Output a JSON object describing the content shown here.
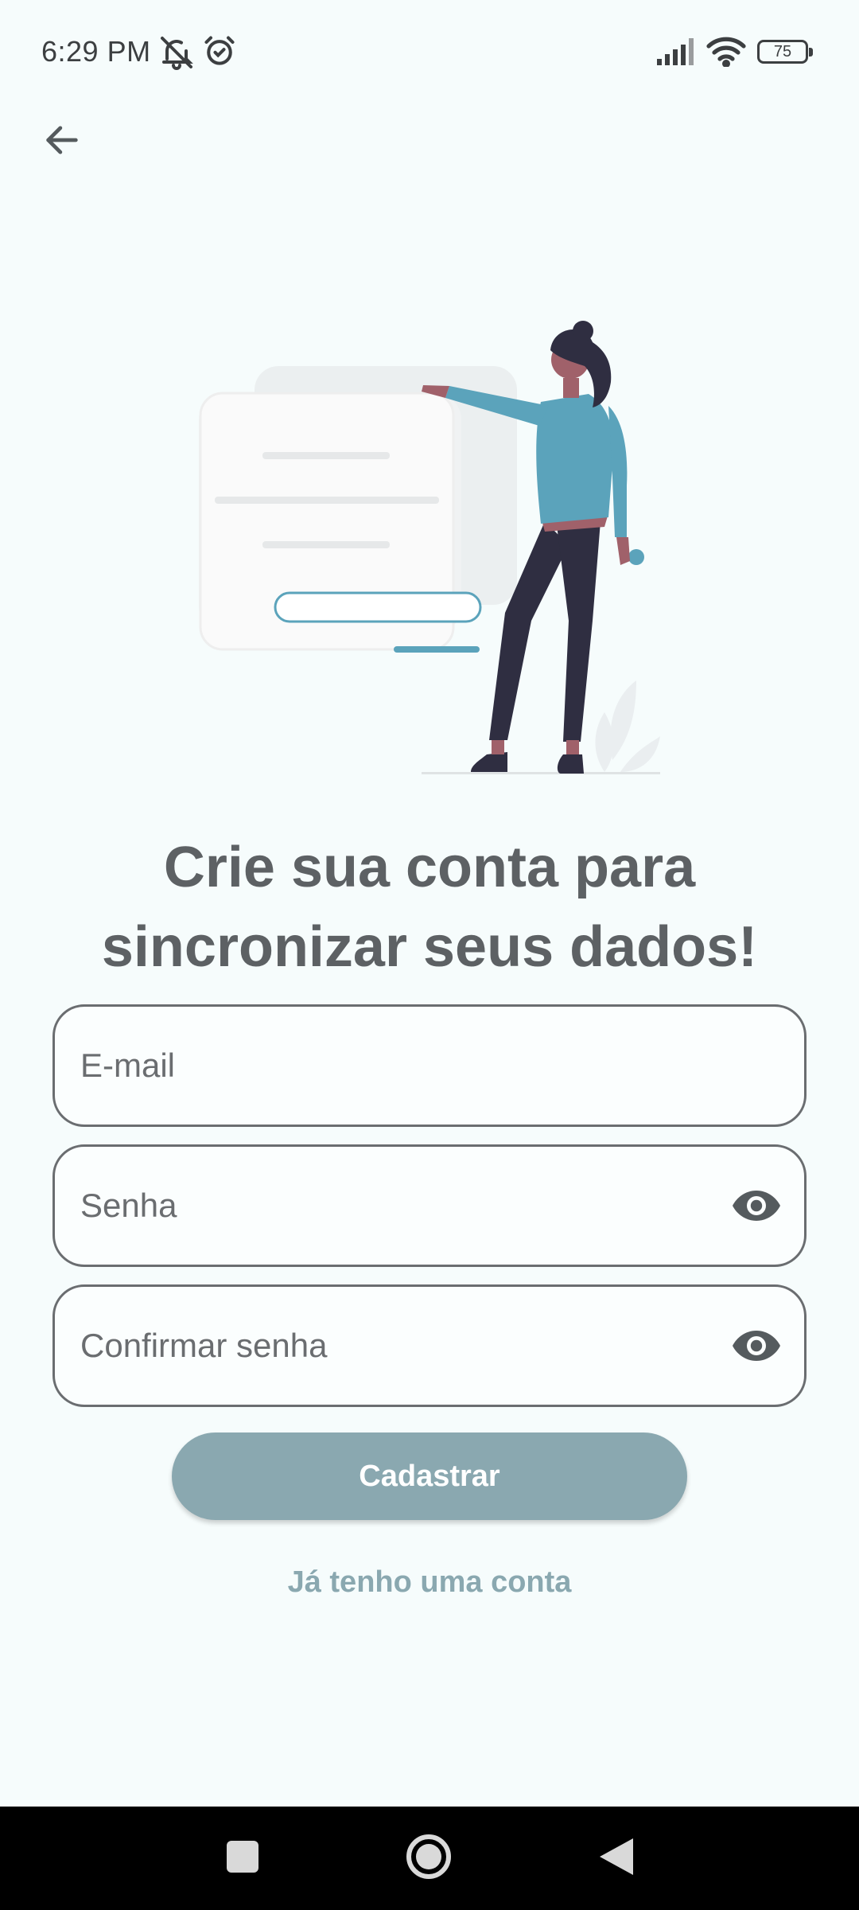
{
  "status_bar": {
    "time": "6:29 PM",
    "icons": [
      "mute-notifications-icon",
      "alarm-icon",
      "signal-icon",
      "wifi-icon"
    ],
    "battery": "75"
  },
  "header": {
    "back_icon": "arrow-back-icon"
  },
  "hero": {
    "title_line1": "Crie sua conta para",
    "title_line2": "sincronizar seus dados!"
  },
  "form": {
    "email": {
      "placeholder": "E-mail",
      "value": ""
    },
    "password": {
      "placeholder": "Senha",
      "value": "",
      "toggle_icon": "eye-icon"
    },
    "confirm_password": {
      "placeholder": "Confirmar senha",
      "value": "",
      "toggle_icon": "eye-icon"
    },
    "submit_label": "Cadastrar",
    "login_link": "Já tenho uma conta"
  },
  "colors": {
    "background": "#f6fcfc",
    "accent": "#8aa8b0",
    "illustration_accent": "#5ba3bb",
    "text": "#5d6164"
  },
  "nav_bar": {
    "icons": [
      "recents-square-icon",
      "home-circle-icon",
      "back-triangle-icon"
    ]
  }
}
